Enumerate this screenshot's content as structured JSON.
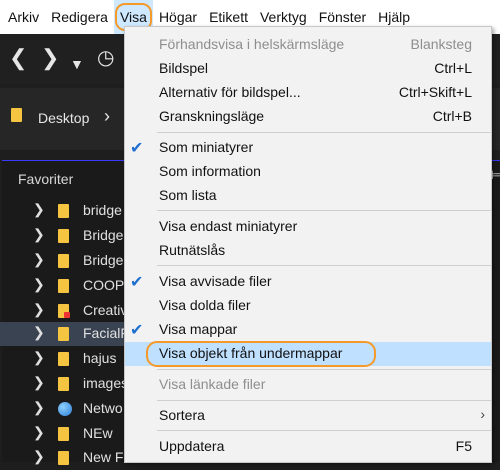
{
  "menubar": {
    "items": [
      "Arkiv",
      "Redigera",
      "Visa",
      "Högar",
      "Etikett",
      "Verktyg",
      "Fönster",
      "Hjälp"
    ],
    "active_index": 2
  },
  "toolbar": {
    "back_icon": "chevron-left-icon",
    "forward_icon": "chevron-right-icon",
    "dropdown_icon": "chevron-down-icon",
    "history_icon": "clock-history-icon"
  },
  "path": {
    "folder_label": "Desktop"
  },
  "panel": {
    "title": "Favoriter"
  },
  "tree": {
    "items": [
      {
        "label": "bridge",
        "icon": "folder-icon"
      },
      {
        "label": "Bridge",
        "icon": "folder-icon"
      },
      {
        "label": "Bridge",
        "icon": "folder-icon"
      },
      {
        "label": "COOPe",
        "icon": "folder-icon"
      },
      {
        "label": "Creativ",
        "icon": "folder-icon"
      },
      {
        "label": "FacialF",
        "icon": "folder-icon",
        "selected": true
      },
      {
        "label": "hajus",
        "icon": "folder-icon"
      },
      {
        "label": "images",
        "icon": "folder-icon"
      },
      {
        "label": "Netwo",
        "icon": "globe-icon"
      },
      {
        "label": "NEw",
        "icon": "folder-icon"
      },
      {
        "label": "New Fo",
        "icon": "folder-icon"
      }
    ]
  },
  "menu": {
    "preview_fullscreen": {
      "label": "Förhandsvisa i helskärmsläge",
      "shortcut": "Blanksteg"
    },
    "slideshow": {
      "label": "Bildspel",
      "shortcut": "Ctrl+L"
    },
    "slideshow_options": {
      "label": "Alternativ för bildspel...",
      "shortcut": "Ctrl+Skift+L"
    },
    "review_mode": {
      "label": "Granskningsläge",
      "shortcut": "Ctrl+B"
    },
    "as_thumbnails": {
      "label": "Som miniatyrer"
    },
    "as_details": {
      "label": "Som information"
    },
    "as_list": {
      "label": "Som lista"
    },
    "thumbnails_only": {
      "label": "Visa endast miniatyrer"
    },
    "grid_lock": {
      "label": "Rutnätslås"
    },
    "show_rejected": {
      "label": "Visa avvisade filer"
    },
    "show_hidden": {
      "label": "Visa dolda filer"
    },
    "show_folders": {
      "label": "Visa mappar"
    },
    "show_subfolder_items": {
      "label": "Visa objekt från undermappar"
    },
    "show_linked": {
      "label": "Visa länkade filer"
    },
    "sort": {
      "label": "Sortera"
    },
    "refresh": {
      "label": "Uppdatera",
      "shortcut": "F5"
    }
  },
  "colors": {
    "highlight_ring": "#f39a2b",
    "check": "#1f6fd1",
    "hover": "#bfe0ff"
  }
}
